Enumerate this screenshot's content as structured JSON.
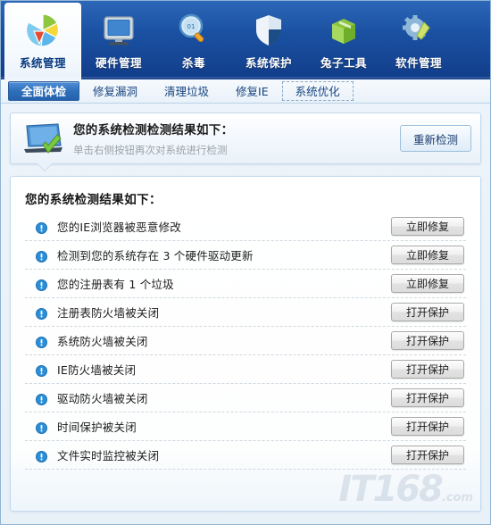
{
  "nav": {
    "items": [
      {
        "label": "系统管理",
        "icon": "pie-chart-icon",
        "active": true
      },
      {
        "label": "硬件管理",
        "icon": "monitor-icon",
        "active": false
      },
      {
        "label": "杀毒",
        "icon": "magnifier-icon",
        "active": false
      },
      {
        "label": "系统保护",
        "icon": "shield-icon",
        "active": false
      },
      {
        "label": "兔子工具",
        "icon": "green-box-icon",
        "active": false
      },
      {
        "label": "软件管理",
        "icon": "gear-wrench-icon",
        "active": false
      }
    ]
  },
  "subtabs": {
    "items": [
      {
        "label": "全面体检",
        "state": "active"
      },
      {
        "label": "修复漏洞",
        "state": "normal"
      },
      {
        "label": "清理垃圾",
        "state": "normal"
      },
      {
        "label": "修复IE",
        "state": "normal"
      },
      {
        "label": "系统优化",
        "state": "dashed"
      }
    ]
  },
  "banner": {
    "icon": "monitor-check-icon",
    "title": "您的系统检测检测结果如下：",
    "subtitle": "单击右侧按钮再次对系统进行检测",
    "rescan_label": "重新检测"
  },
  "results": {
    "title": "您的系统检测结果如下：",
    "rows": [
      {
        "icon": "warning-icon",
        "label": "您的IE浏览器被恶意修改",
        "button": "立即修复"
      },
      {
        "icon": "warning-icon",
        "label": "检测到您的系统存在 3 个硬件驱动更新",
        "button": "立即修复"
      },
      {
        "icon": "warning-icon",
        "label": "您的注册表有 1 个垃圾",
        "button": "立即修复"
      },
      {
        "icon": "warning-icon",
        "label": "注册表防火墙被关闭",
        "button": "打开保护"
      },
      {
        "icon": "warning-icon",
        "label": "系统防火墙被关闭",
        "button": "打开保护"
      },
      {
        "icon": "warning-icon",
        "label": "IE防火墙被关闭",
        "button": "打开保护"
      },
      {
        "icon": "warning-icon",
        "label": "驱动防火墙被关闭",
        "button": "打开保护"
      },
      {
        "icon": "warning-icon",
        "label": "时间保护被关闭",
        "button": "打开保护"
      },
      {
        "icon": "warning-icon",
        "label": "文件实时监控被关闭",
        "button": "打开保护"
      }
    ]
  },
  "watermark": {
    "text": "IT168",
    "suffix": ".com"
  },
  "colors": {
    "nav_blue_top": "#2d67b8",
    "nav_blue_bottom": "#113d8a",
    "active_tab_blue": "#2f6fba",
    "panel_border": "#c2d9ec",
    "warning_icon_blue": "#2a8fd8"
  }
}
